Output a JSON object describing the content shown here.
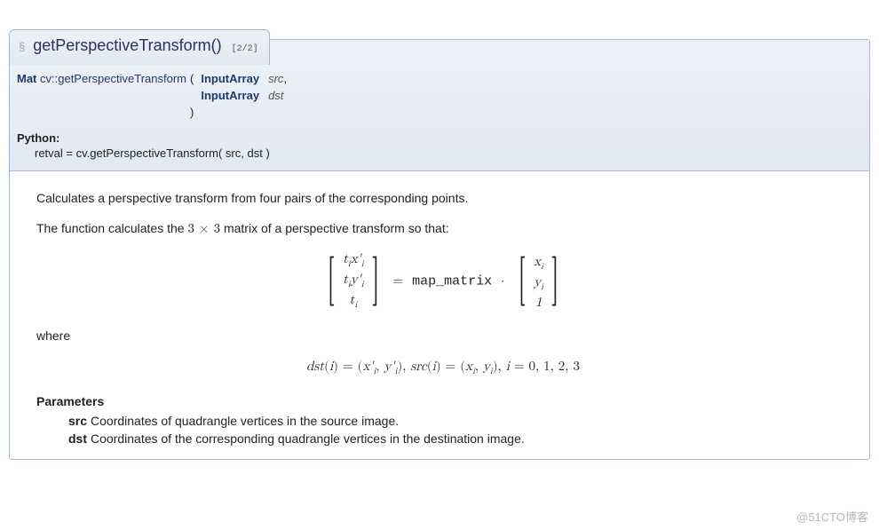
{
  "header": {
    "permalink_symbol": "§",
    "func_name": "getPerspectiveTransform()",
    "overload": "[2/2]"
  },
  "signature": {
    "return_type": "Mat",
    "scope": "cv::getPerspectiveTransform",
    "open_paren": "(",
    "params": [
      {
        "type": "InputArray",
        "name": "src",
        "trail": ","
      },
      {
        "type": "InputArray",
        "name": "dst",
        "trail": ""
      }
    ],
    "close_paren": ")"
  },
  "python": {
    "label": "Python:",
    "sig": "retval = cv.getPerspectiveTransform( src, dst )"
  },
  "doc": {
    "brief": "Calculates a perspective transform from four pairs of the corresponding points.",
    "desc_prefix": "The function calculates the ",
    "desc_matrix": "3 × 3",
    "desc_suffix": " matrix of a perspective transform so that:",
    "eq1": {
      "left": [
        "t_i x'_i",
        "t_i y'_i",
        "t_i"
      ],
      "op1": "=",
      "mid": "map_matrix",
      "op2": "·",
      "right": [
        "x_i",
        "y_i",
        "1"
      ]
    },
    "where_label": "where",
    "eq2": "dst(i) = (x'_i, y'_i), src(i) = (x_i, y_i), i = 0, 1, 2, 3",
    "params_hdr": "Parameters",
    "params": [
      {
        "name": "src",
        "desc": "Coordinates of quadrangle vertices in the source image."
      },
      {
        "name": "dst",
        "desc": "Coordinates of the corresponding quadrangle vertices in the destination image."
      }
    ]
  },
  "watermark": "@51CTO博客"
}
